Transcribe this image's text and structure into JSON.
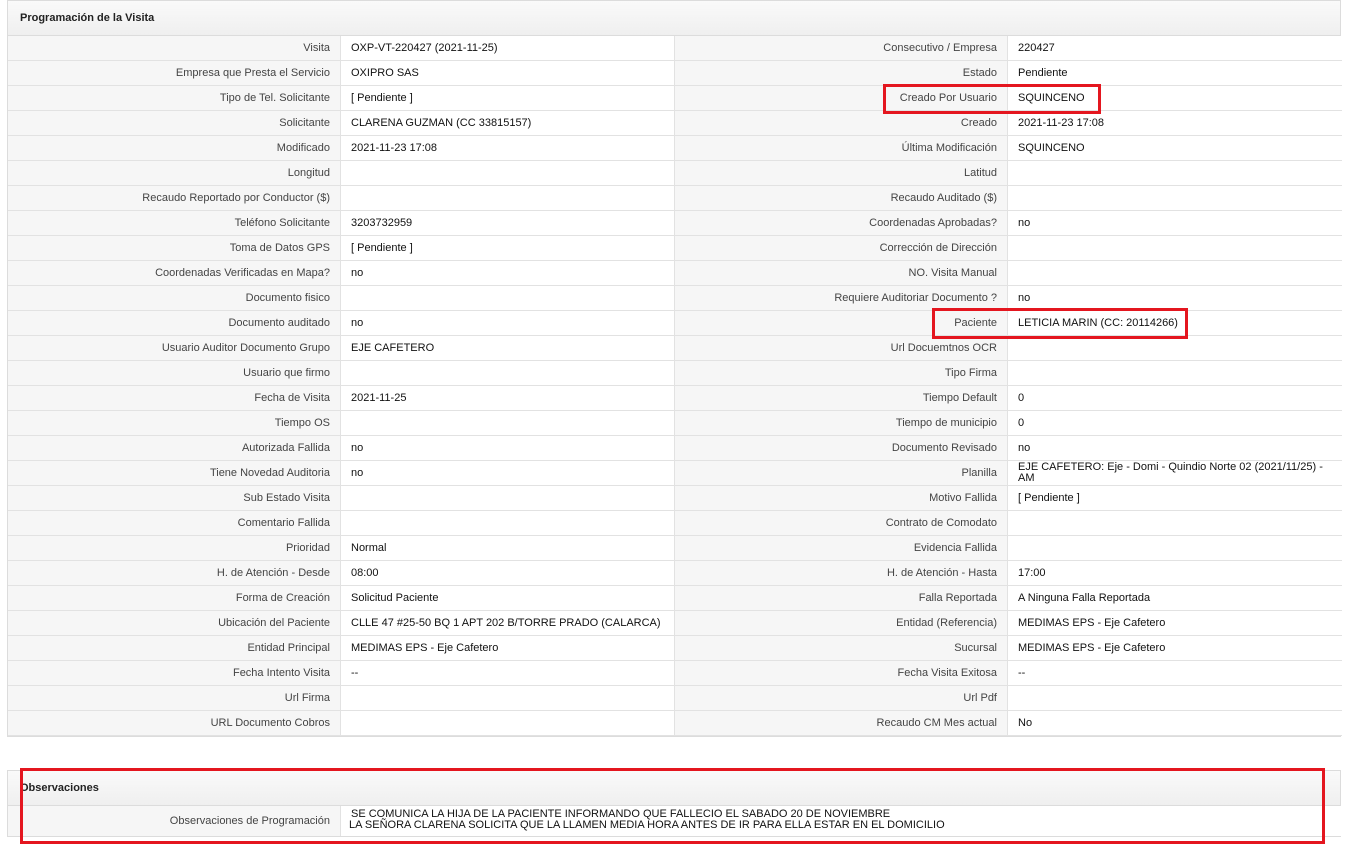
{
  "main_section": {
    "title": "Programación de la Visita",
    "rows": [
      {
        "l1": "Visita",
        "v1": "OXP-VT-220427 (2021-11-25)",
        "l2": "Consecutivo / Empresa",
        "v2": "220427"
      },
      {
        "l1": "Empresa que Presta el Servicio",
        "v1": "OXIPRO SAS",
        "l2": "Estado",
        "v2": "Pendiente"
      },
      {
        "l1": "Tipo de Tel. Solicitante",
        "v1": "[ Pendiente ]",
        "l2": "Creado Por Usuario",
        "v2": "SQUINCENO"
      },
      {
        "l1": "Solicitante",
        "v1": "CLARENA GUZMAN (CC 33815157)",
        "l2": "Creado",
        "v2": "2021-11-23 17:08"
      },
      {
        "l1": "Modificado",
        "v1": "2021-11-23 17:08",
        "l2": "Última Modificación",
        "v2": " SQUINCENO"
      },
      {
        "l1": "Longitud",
        "v1": "",
        "l2": "Latitud",
        "v2": ""
      },
      {
        "l1": "Recaudo Reportado por Conductor ($)",
        "v1": "",
        "l2": "Recaudo Auditado ($)",
        "v2": ""
      },
      {
        "l1": "Teléfono Solicitante",
        "v1": "3203732959",
        "l2": "Coordenadas Aprobadas?",
        "v2": " no"
      },
      {
        "l1": "Toma de Datos GPS",
        "v1": "[ Pendiente ]",
        "l2": "Corrección de Dirección",
        "v2": ""
      },
      {
        "l1": "Coordenadas Verificadas en Mapa?",
        "v1": " no",
        "l2": "NO. Visita Manual",
        "v2": ""
      },
      {
        "l1": "Documento fisico",
        "v1": "",
        "l2": "Requiere Auditoriar Documento ?",
        "v2": " no"
      },
      {
        "l1": "Documento auditado",
        "v1": " no",
        "l2": "Paciente",
        "v2": "LETICIA MARIN (CC: 20114266)"
      },
      {
        "l1": "Usuario Auditor Documento Grupo",
        "v1": "EJE CAFETERO",
        "l2": "Url Docuemtnos OCR",
        "v2": ""
      },
      {
        "l1": "Usuario que firmo",
        "v1": "",
        "l2": "Tipo Firma",
        "v2": ""
      },
      {
        "l1": "Fecha de Visita",
        "v1": " 2021-11-25",
        "l2": "Tiempo Default",
        "v2": "0"
      },
      {
        "l1": "Tiempo OS",
        "v1": "",
        "l2": "Tiempo de municipio",
        "v2": "0"
      },
      {
        "l1": "Autorizada Fallida",
        "v1": " no",
        "l2": "Documento Revisado",
        "v2": " no"
      },
      {
        "l1": "Tiene Novedad Auditoria",
        "v1": " no",
        "l2": "Planilla",
        "v2": "EJE CAFETERO: Eje - Domi - Quindio Norte 02 (2021/11/25) - AM"
      },
      {
        "l1": "Sub Estado Visita",
        "v1": "",
        "l2": "Motivo Fallida",
        "v2": "[ Pendiente ]"
      },
      {
        "l1": "Comentario Fallida",
        "v1": "",
        "l2": "Contrato de Comodato",
        "v2": ""
      },
      {
        "l1": "Prioridad",
        "v1": "Normal",
        "l2": "Evidencia Fallida",
        "v2": ""
      },
      {
        "l1": "H. de Atención - Desde",
        "v1": "08:00",
        "l2": "H. de Atención - Hasta",
        "v2": "17:00"
      },
      {
        "l1": "Forma de Creación",
        "v1": "Solicitud Paciente",
        "l2": "Falla Reportada",
        "v2": "A Ninguna Falla Reportada"
      },
      {
        "l1": "Ubicación del Paciente",
        "v1": "CLLE 47 #25-50 BQ 1 APT 202 B/TORRE PRADO (CALARCA)",
        "l2": "Entidad (Referencia)",
        "v2": "MEDIMAS EPS - Eje Cafetero"
      },
      {
        "l1": "Entidad Principal",
        "v1": "MEDIMAS EPS - Eje Cafetero",
        "l2": "Sucursal",
        "v2": "MEDIMAS EPS - Eje Cafetero"
      },
      {
        "l1": "Fecha Intento Visita",
        "v1": " --",
        "l2": "Fecha Visita Exitosa",
        "v2": " --"
      },
      {
        "l1": "Url Firma",
        "v1": "",
        "l2": "Url Pdf",
        "v2": ""
      },
      {
        "l1": "URL Documento Cobros",
        "v1": "",
        "l2": "Recaudo CM Mes actual",
        "v2": " No"
      }
    ]
  },
  "observations": {
    "title": "Observaciones",
    "label": "Observaciones de Programación",
    "line1": "SE COMUNICA LA HIJA DE LA PACIENTE INFORMANDO QUE FALLECIO EL SABADO 20 DE NOVIEMBRE",
    "line2": "LA SEÑORA CLARENA SOLICITA QUE LA LLAMEN MEDIA HORA ANTES DE IR PARA ELLA ESTAR EN EL DOMICILIO"
  },
  "colors": {
    "highlight": "#e4161f",
    "label_bg": "#f6f6f6",
    "border": "#e2e2e2"
  }
}
